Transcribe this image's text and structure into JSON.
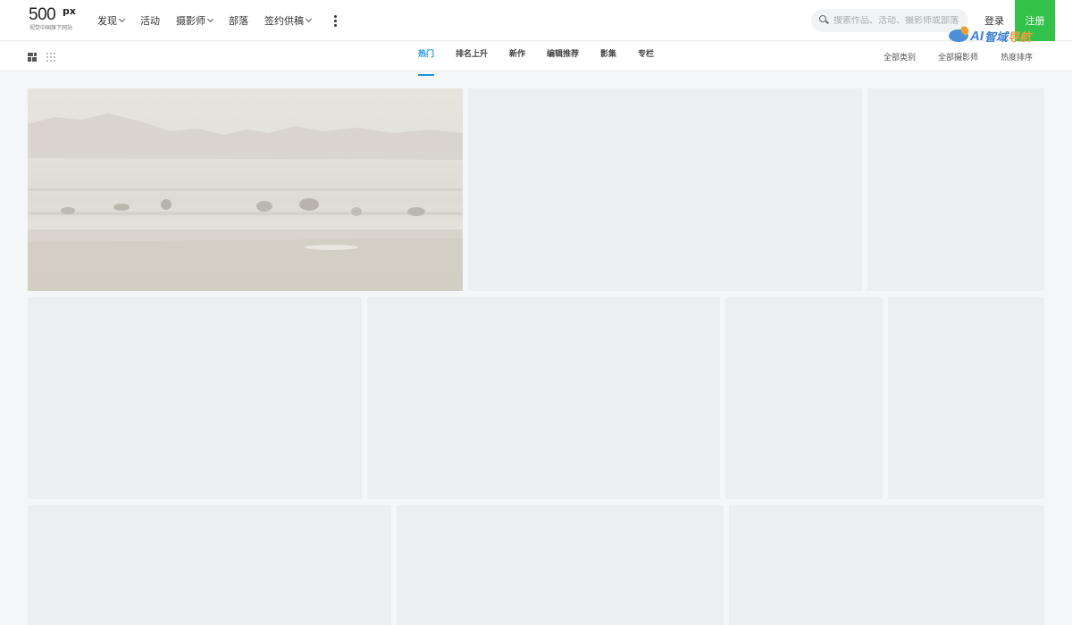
{
  "logo": {
    "main": "500",
    "sup": "px",
    "sub": "视觉中国旗下网站"
  },
  "nav": {
    "items": [
      {
        "label": "发现",
        "dropdown": true
      },
      {
        "label": "活动",
        "dropdown": false
      },
      {
        "label": "摄影师",
        "dropdown": true
      },
      {
        "label": "部落",
        "dropdown": false
      },
      {
        "label": "签约供稿",
        "dropdown": true
      }
    ],
    "more_icon": "vertical-ellipsis-icon"
  },
  "search": {
    "placeholder": "搜索作品、活动、摄影师或部落",
    "value": ""
  },
  "auth": {
    "login": "登录",
    "register": "注册"
  },
  "watermark": {
    "text1": "AI",
    "text2": "智域",
    "text3": "导航"
  },
  "subnav": {
    "tabs": [
      "热门",
      "排名上升",
      "新作",
      "编辑推荐",
      "影集",
      "专栏"
    ],
    "active_tab": "热门",
    "filters": [
      "全部类别",
      "全部摄影师",
      "热度排序"
    ]
  },
  "colors": {
    "accent": "#1f93d6",
    "register_bg": "#33c14a",
    "placeholder_tile": "#eceef2",
    "page_bg": "#f5f6f8"
  },
  "gallery": {
    "tile_count": 12,
    "loaded_photos": 1,
    "first_photo": "misty lake with birds"
  }
}
